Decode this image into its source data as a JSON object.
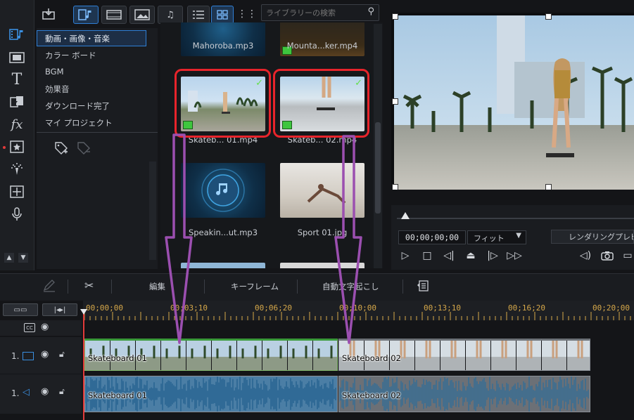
{
  "toolbar": {
    "search_placeholder": "ライブラリーの検索"
  },
  "categories": {
    "items": [
      "動画・画像・音楽",
      "カラー ボード",
      "BGM",
      "効果音",
      "ダウンロード完了",
      "マイ プロジェクト"
    ],
    "selected": "動画・画像・音楽"
  },
  "library": {
    "items": [
      {
        "name": "Mahoroba.mp3"
      },
      {
        "name": "Mounta...ker.mp4"
      },
      {
        "name": "Skateb... 01.mp4",
        "checked": true
      },
      {
        "name": "Skateb... 02.mp4",
        "checked": true
      },
      {
        "name": "Speakin...ut.mp3"
      },
      {
        "name": "Sport 01.jpg"
      }
    ]
  },
  "preview": {
    "timecode": "00;00;00;00",
    "fit": "フィット",
    "render_label": "レンダリングプレビュー"
  },
  "timeline_toolbar": {
    "edit": "編集",
    "keyframe": "キーフレーム",
    "auto_caption": "自動文字起こし"
  },
  "ruler": {
    "labels": [
      "00;00;00",
      "00;03;10",
      "00;06;20",
      "00;10;00",
      "00;13;10",
      "00;16;20",
      "00;20;00"
    ]
  },
  "tracks": {
    "video": {
      "label": "1.",
      "clips": [
        "Skateboard 01",
        "Skateboard 02"
      ]
    },
    "audio": {
      "label": "1.",
      "clips": [
        "Skateboard 01",
        "Skateboard 02"
      ]
    }
  },
  "colors": {
    "accent": "#2f7fd6",
    "highlight": "#e8242b",
    "arrow": "#9b4fb0",
    "clip_green": "#3a9a3a"
  }
}
